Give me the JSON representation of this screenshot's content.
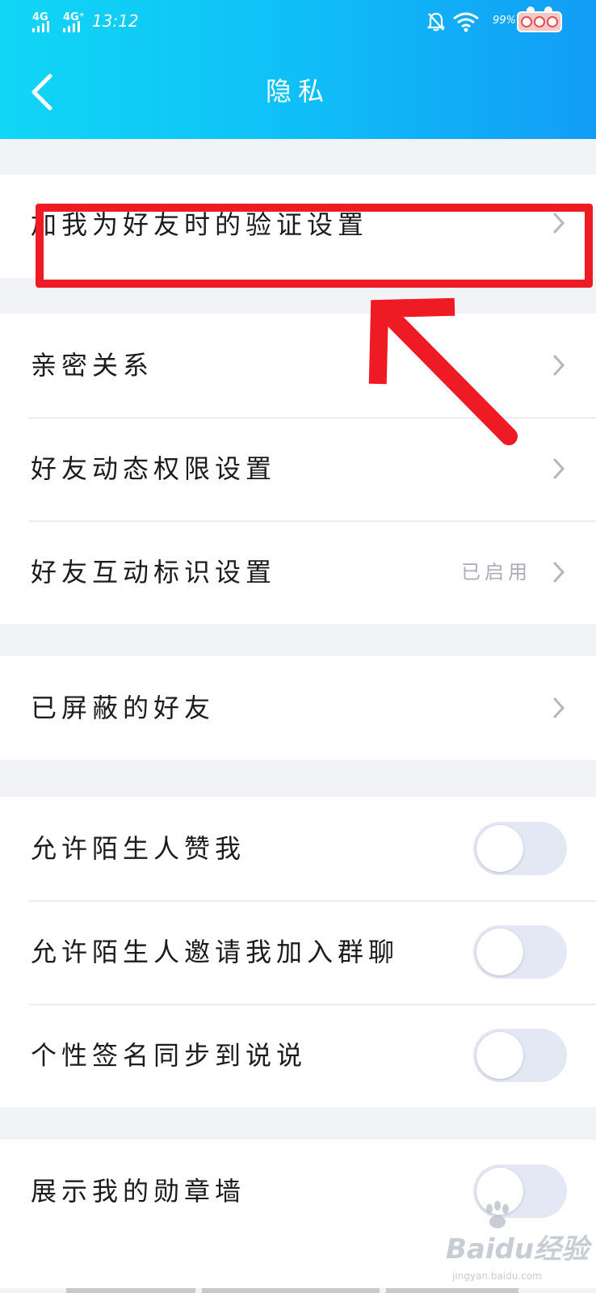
{
  "status_bar": {
    "network_1": "4G",
    "network_2": "4G⁺",
    "time": "13:12",
    "battery_percent": "99%"
  },
  "header": {
    "title": "隐私"
  },
  "groups": [
    {
      "items": [
        {
          "label": "加我为好友时的验证设置",
          "type": "nav"
        }
      ]
    },
    {
      "items": [
        {
          "label": "亲密关系",
          "type": "nav"
        },
        {
          "label": "好友动态权限设置",
          "type": "nav"
        },
        {
          "label": "好友互动标识设置",
          "type": "nav",
          "value": "已启用"
        }
      ]
    },
    {
      "items": [
        {
          "label": "已屏蔽的好友",
          "type": "nav"
        }
      ]
    },
    {
      "items": [
        {
          "label": "允许陌生人赞我",
          "type": "toggle",
          "on": false
        },
        {
          "label": "允许陌生人邀请我加入群聊",
          "type": "toggle",
          "on": false
        },
        {
          "label": "个性签名同步到说说",
          "type": "toggle",
          "on": false
        }
      ]
    },
    {
      "items": [
        {
          "label": "展示我的勋章墙",
          "type": "toggle",
          "on": false
        }
      ]
    }
  ],
  "watermark": {
    "brand": "Baidu经验",
    "site": "jingyan.baidu.com"
  },
  "colors": {
    "header_start": "#11d6f6",
    "header_end": "#129df6",
    "annotation": "#ee1a24",
    "toggle_off": "#e4e8f4"
  }
}
